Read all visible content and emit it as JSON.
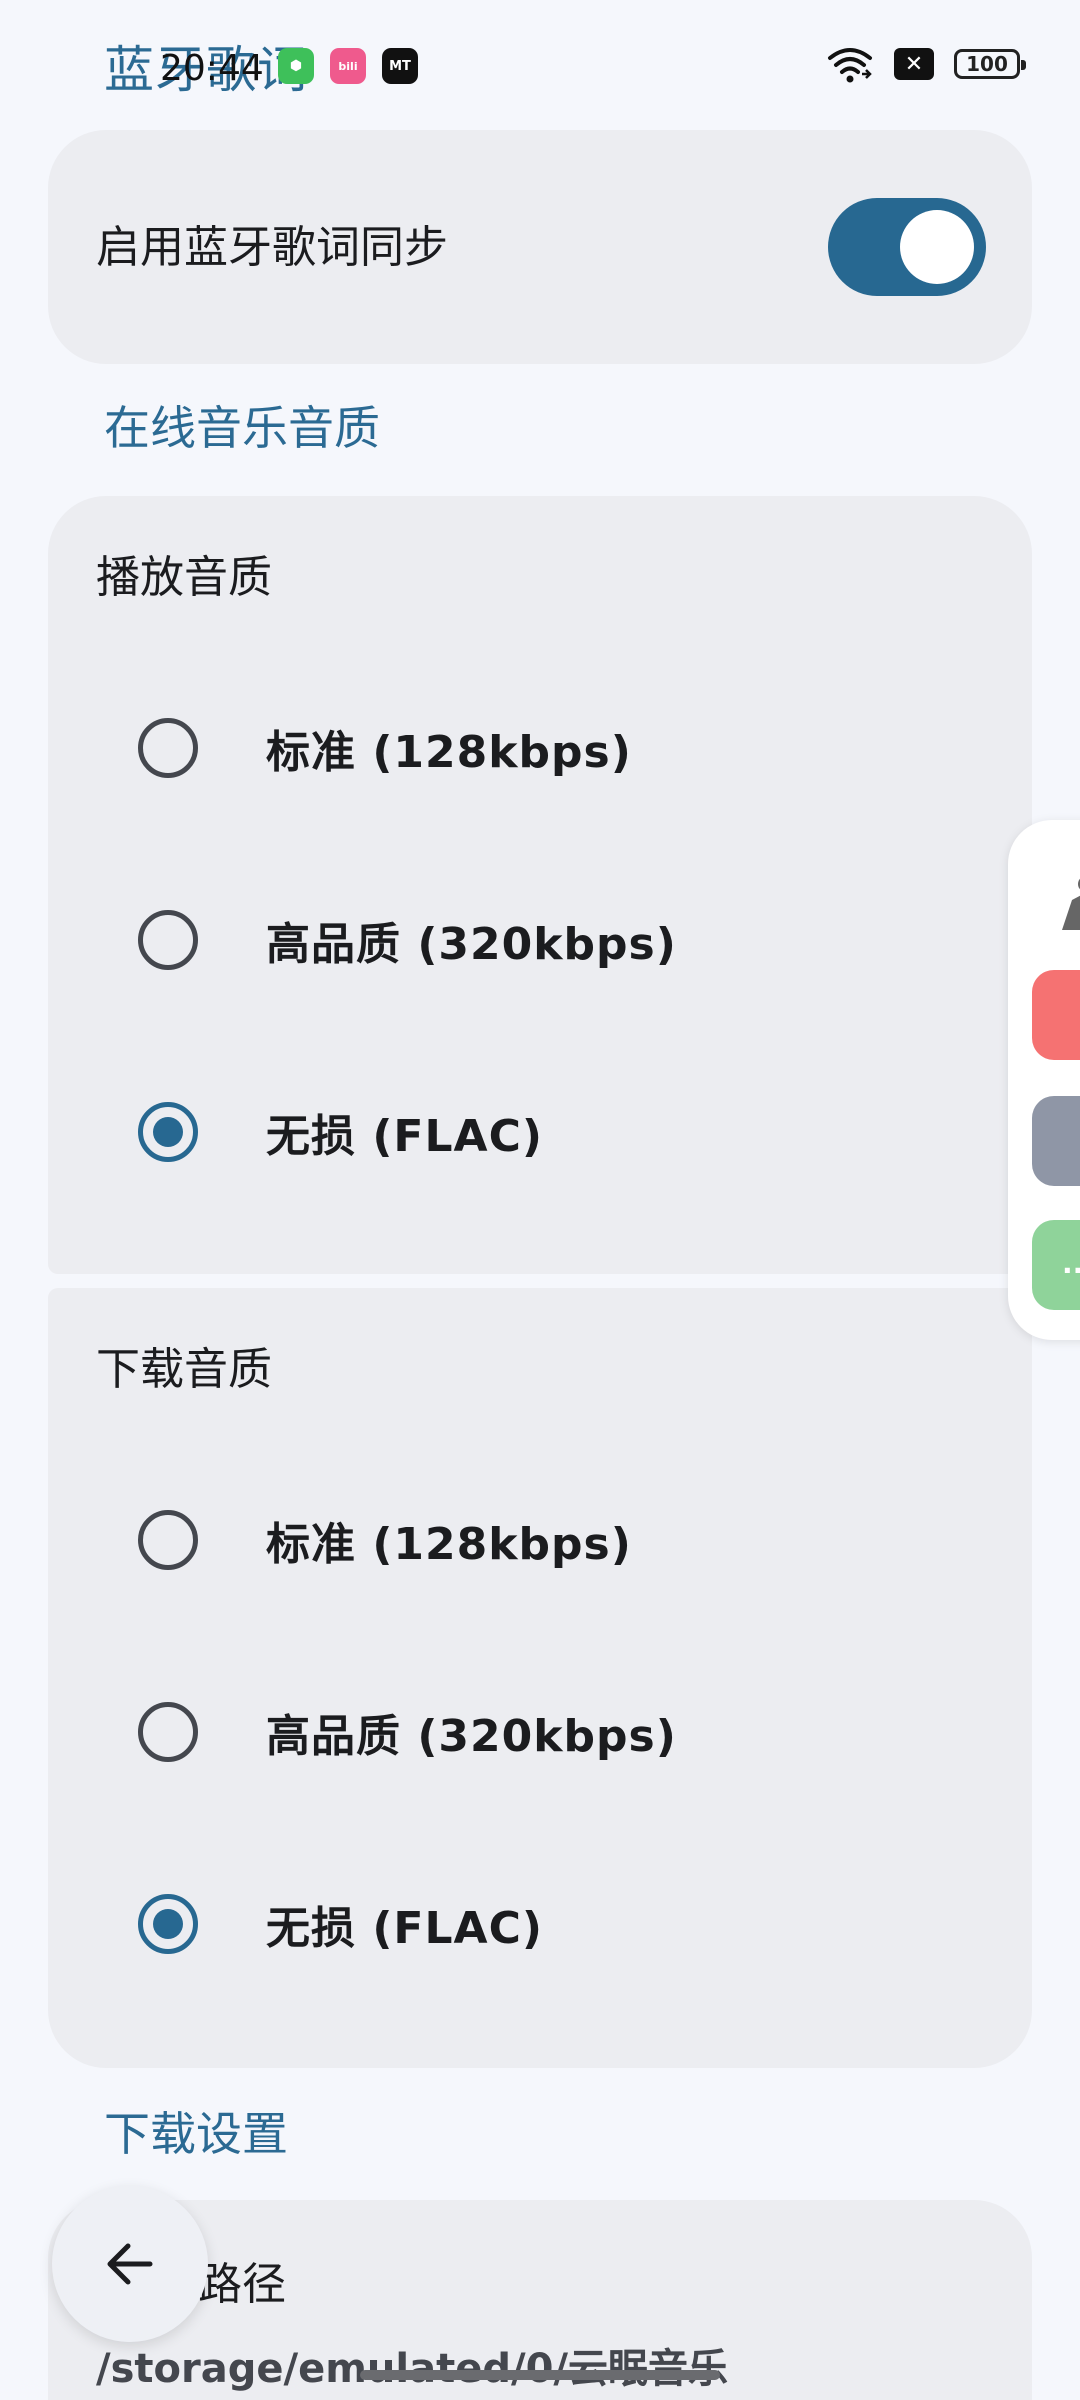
{
  "status_bar": {
    "time": "20:44",
    "battery": "100",
    "app_icons": [
      "shield-app-icon",
      "bilibili-icon",
      "mt-manager-icon"
    ],
    "app_icon_labels": [
      "⬢",
      "bili",
      "MT"
    ]
  },
  "header": {
    "title": "蓝牙歌词"
  },
  "bluetooth": {
    "label": "启用蓝牙歌词同步",
    "enabled": true
  },
  "sections": {
    "online_quality": "在线音乐音质",
    "download_settings": "下载设置"
  },
  "playback_quality": {
    "title": "播放音质",
    "options": [
      {
        "label": "标准 (128kbps)",
        "selected": false
      },
      {
        "label": "高品质 (320kbps)",
        "selected": false
      },
      {
        "label": "无损 (FLAC)",
        "selected": true
      }
    ]
  },
  "download_quality": {
    "title": "下载音质",
    "options": [
      {
        "label": "标准 (128kbps)",
        "selected": false
      },
      {
        "label": "高品质 (320kbps)",
        "selected": false
      },
      {
        "label": "无损 (FLAC)",
        "selected": true
      }
    ]
  },
  "download_path": {
    "title": "路径",
    "value": "/storage/emulated/0/云眠音乐"
  },
  "side_panel": {
    "apps": [
      "figure-app-icon",
      "transfer-app-icon",
      "screen-app-icon",
      "more-app-icon"
    ],
    "more_label": "··"
  },
  "colors": {
    "accent": "#276891",
    "background": "#f5f7fc",
    "card": "#ecedf1"
  }
}
